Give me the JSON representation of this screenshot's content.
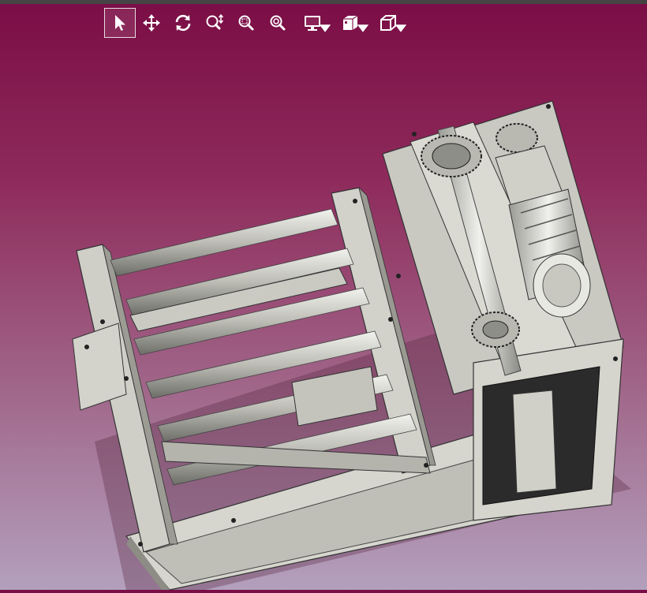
{
  "toolbar": {
    "tools": [
      {
        "id": "select",
        "icon": "cursor-arrow-icon",
        "active": true
      },
      {
        "id": "pan",
        "icon": "move-arrows-icon",
        "active": false
      },
      {
        "id": "rotate",
        "icon": "rotate-icon",
        "active": false
      },
      {
        "id": "zoom-dynamic",
        "icon": "zoom-dynamic-icon",
        "active": false
      },
      {
        "id": "zoom-window",
        "icon": "zoom-window-icon",
        "active": false
      },
      {
        "id": "zoom-fit",
        "icon": "zoom-fit-icon",
        "active": false
      },
      {
        "id": "display",
        "icon": "monitor-icon",
        "dropdown": true
      },
      {
        "id": "views",
        "icon": "views-icon",
        "dropdown": true
      },
      {
        "id": "cube",
        "icon": "cube-icon",
        "dropdown": true
      }
    ]
  },
  "colors": {
    "background_top": "#7a0d45",
    "background_bottom": "#b3a0bd",
    "model_light": "#d6d6cf",
    "model_dark": "#2b2b2b",
    "icon": "#ffffff"
  }
}
